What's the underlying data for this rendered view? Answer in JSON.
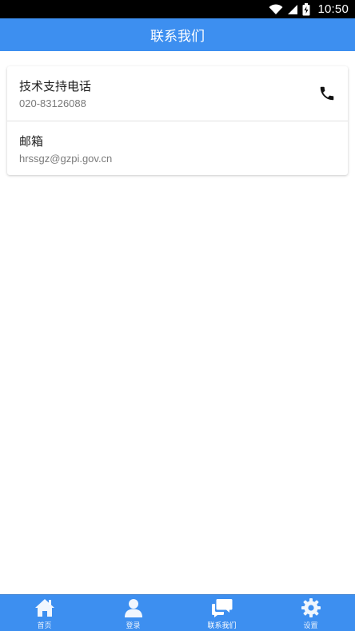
{
  "status_bar": {
    "time": "10:50",
    "icons": [
      "wifi-icon",
      "signal-icon",
      "battery-icon"
    ]
  },
  "header": {
    "title": "联系我们"
  },
  "contacts": [
    {
      "title": "技术支持电话",
      "value": "020-83126088",
      "icon": "phone-icon"
    },
    {
      "title": "邮箱",
      "value": "hrssgz@gzpi.gov.cn"
    }
  ],
  "bottom_nav": {
    "items": [
      {
        "label": "首页",
        "icon": "home-icon"
      },
      {
        "label": "登录",
        "icon": "user-icon"
      },
      {
        "label": "联系我们",
        "icon": "chat-icon",
        "active": true
      },
      {
        "label": "设置",
        "icon": "gear-icon"
      }
    ]
  },
  "colors": {
    "primary": "#3d8ff0",
    "status_bar": "#000000",
    "background": "#ffffff"
  }
}
